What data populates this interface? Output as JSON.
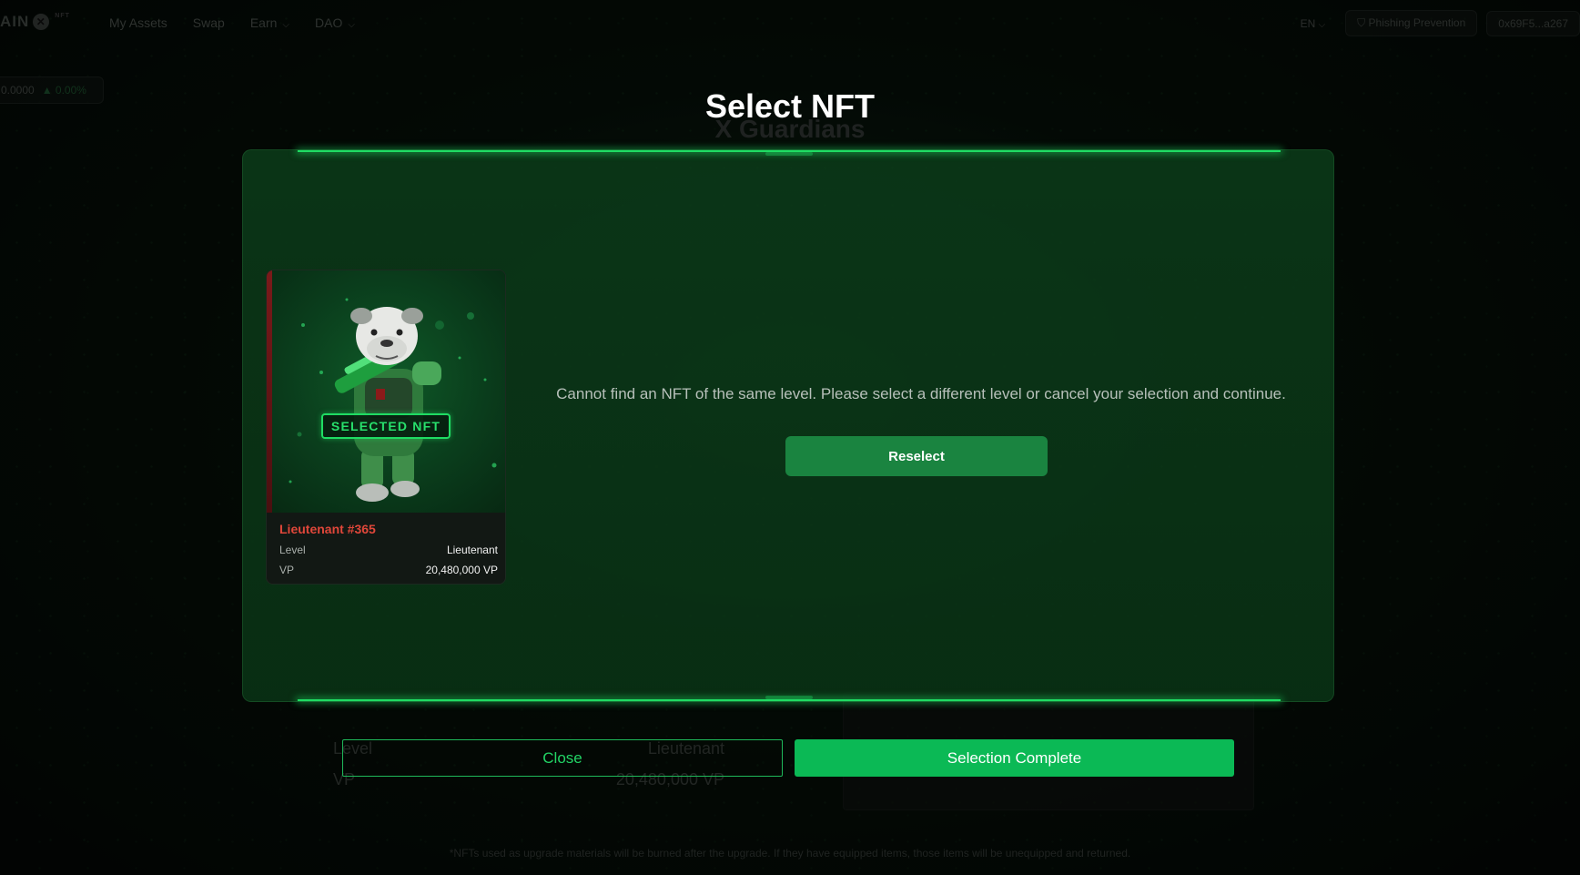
{
  "colors": {
    "accent": "#1fdc63",
    "button_green": "#0bb955",
    "reselect_green": "#1a8440",
    "nft_name_red": "#e0473a"
  },
  "background": {
    "logo": {
      "text": "AIN",
      "superscript": "NFT"
    },
    "nav": [
      {
        "label": "My Assets",
        "has_dropdown": false
      },
      {
        "label": "Swap",
        "has_dropdown": false
      },
      {
        "label": "Earn",
        "has_dropdown": true
      },
      {
        "label": "DAO",
        "has_dropdown": true
      }
    ],
    "language": "EN",
    "phishing_label": "Phishing Prevention",
    "wallet_address": "0x69F5...a267",
    "price": {
      "value": "0.0000",
      "change": "▲ 0.00%"
    },
    "page_title": "X Guardians",
    "level_label": "Level",
    "level_value": "Lieutenant",
    "vp_label": "VP",
    "vp_value": "20,480,000 VP",
    "footnote": "*NFTs used as upgrade materials will be burned after the upgrade. If they have equipped items, those items will be unequipped and returned."
  },
  "modal": {
    "title": "Select NFT",
    "message": "Cannot find an NFT of the same level. Please select a different level or cancel your selection and continue.",
    "reselect_label": "Reselect",
    "close_label": "Close",
    "complete_label": "Selection Complete"
  },
  "nft_card": {
    "badge": "SELECTED NFT",
    "name": "Lieutenant #365",
    "level_label": "Level",
    "level_value": "Lieutenant",
    "vp_label": "VP",
    "vp_value": "20,480,000 VP",
    "icon": "bulldog-soldier-image"
  }
}
